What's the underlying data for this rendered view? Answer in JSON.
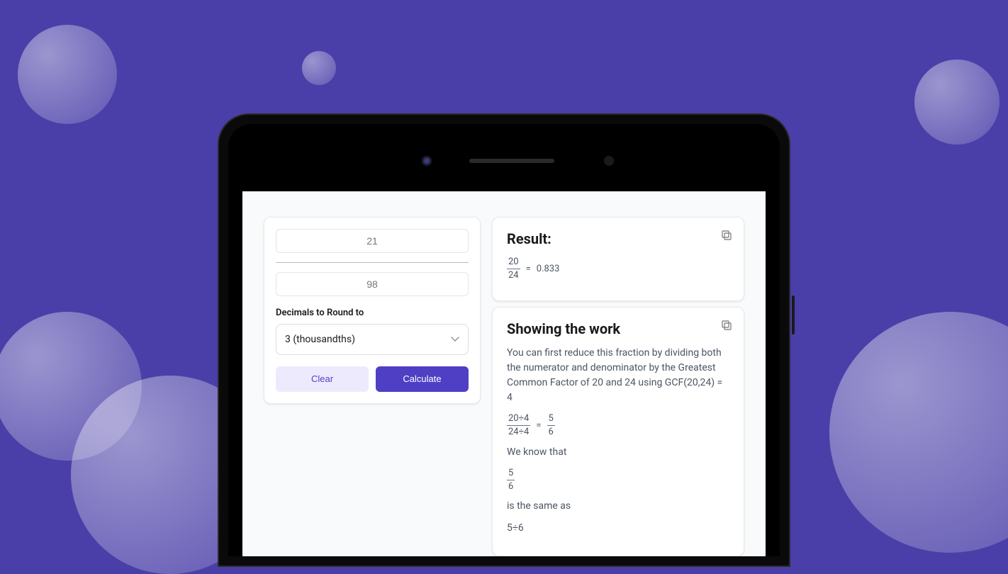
{
  "inputs": {
    "numerator_placeholder": "21",
    "denominator_placeholder": "98",
    "decimals_label": "Decimals to Round to",
    "decimals_value": "3 (thousandths)"
  },
  "buttons": {
    "clear": "Clear",
    "calculate": "Calculate"
  },
  "result": {
    "title": "Result:",
    "fraction_num": "20",
    "fraction_den": "24",
    "equals": "=",
    "decimal": "0.833"
  },
  "work": {
    "title": "Showing the work",
    "explanation": "You can first reduce this fraction by dividing both the numerator and denominator by the Greatest Common Factor of 20 and 24 using GCF(20,24) = 4",
    "step1_num": "20÷4",
    "step1_den": "24÷4",
    "step1_equals": "=",
    "step1_res_num": "5",
    "step1_res_den": "6",
    "line2": "We know that",
    "step2_num": "5",
    "step2_den": "6",
    "line3": "is the same as",
    "line4": "5÷6"
  }
}
